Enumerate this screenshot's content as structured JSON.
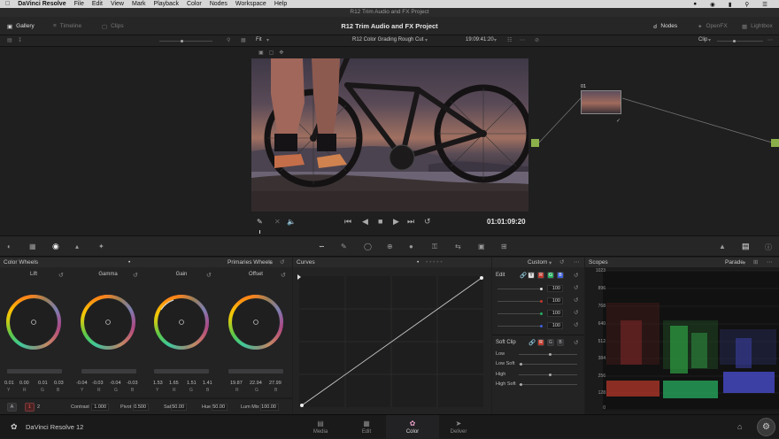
{
  "menubar": {
    "apple": "",
    "app": "DaVinci Resolve",
    "items": [
      "File",
      "Edit",
      "View",
      "Mark",
      "Playback",
      "Color",
      "Nodes",
      "Workspace",
      "Help"
    ]
  },
  "window_title": "R12 Trim Audio and FX Project",
  "topbar": {
    "gallery": "Gallery",
    "timeline": "Timeline",
    "clips": "Clips",
    "project_title": "R12 Trim Audio and FX Project",
    "nodes": "Nodes",
    "openfx": "OpenFX",
    "lightbox": "Lightbox"
  },
  "viewerbar": {
    "fit": "Fit",
    "timeline_name": "R12 Color Grading Rough Cut",
    "timecode": "19:09:41:20",
    "clip_mode": "Clip"
  },
  "viewer": {
    "timecode": "01:01:09:20"
  },
  "node": {
    "label": "01"
  },
  "color_wheels": {
    "title": "Color Wheels",
    "mode": "Primaries Wheels",
    "wheels": [
      {
        "name": "Lift",
        "values": [
          "0.01",
          "0.00",
          "0.01",
          "0.03"
        ]
      },
      {
        "name": "Gamma",
        "values": [
          "-0.04",
          "-0.03",
          "-0.04",
          "-0.03"
        ]
      },
      {
        "name": "Gain",
        "values": [
          "1.53",
          "1.65",
          "1.51",
          "1.41"
        ]
      },
      {
        "name": "Offset",
        "values": [
          "19.87",
          "22.94",
          "27.99",
          ""
        ]
      }
    ],
    "channels": [
      "Y",
      "R",
      "G",
      "B"
    ],
    "offset_channels": [
      "R",
      "G",
      "B"
    ],
    "page_a": "A",
    "page_1": "1",
    "page_2": "2",
    "contrast_label": "Contrast",
    "contrast": "1.000",
    "pivot_label": "Pivot",
    "pivot": "0.500",
    "sat_label": "Sat",
    "sat": "50.00",
    "hue_label": "Hue",
    "hue": "50.00",
    "lummix_label": "Lum Mix",
    "lummix": "100.00"
  },
  "curves": {
    "title": "Curves",
    "mode": "Custom"
  },
  "edit": {
    "title": "Edit",
    "channel_buttons": [
      "Y",
      "R",
      "G",
      "B"
    ],
    "values": [
      "100",
      "100",
      "100",
      "100"
    ],
    "soft_clip": "Soft Clip",
    "soft_clip_buttons": [
      "R",
      "G",
      "B"
    ],
    "low": "Low",
    "low_soft": "Low Soft",
    "high": "High",
    "high_soft": "High Soft"
  },
  "scopes": {
    "title": "Scopes",
    "mode": "Parade",
    "y_ticks": [
      "1023",
      "896",
      "768",
      "640",
      "512",
      "384",
      "256",
      "128",
      "0"
    ]
  },
  "bottom": {
    "app_name": "DaVinci Resolve 12",
    "pages": [
      "Media",
      "Edit",
      "Color",
      "Deliver"
    ],
    "active_page": "Color"
  },
  "colors": {
    "accent": "#e84c3d",
    "red": "#c0392b",
    "green": "#27ae60",
    "blue": "#3d5fd6"
  }
}
